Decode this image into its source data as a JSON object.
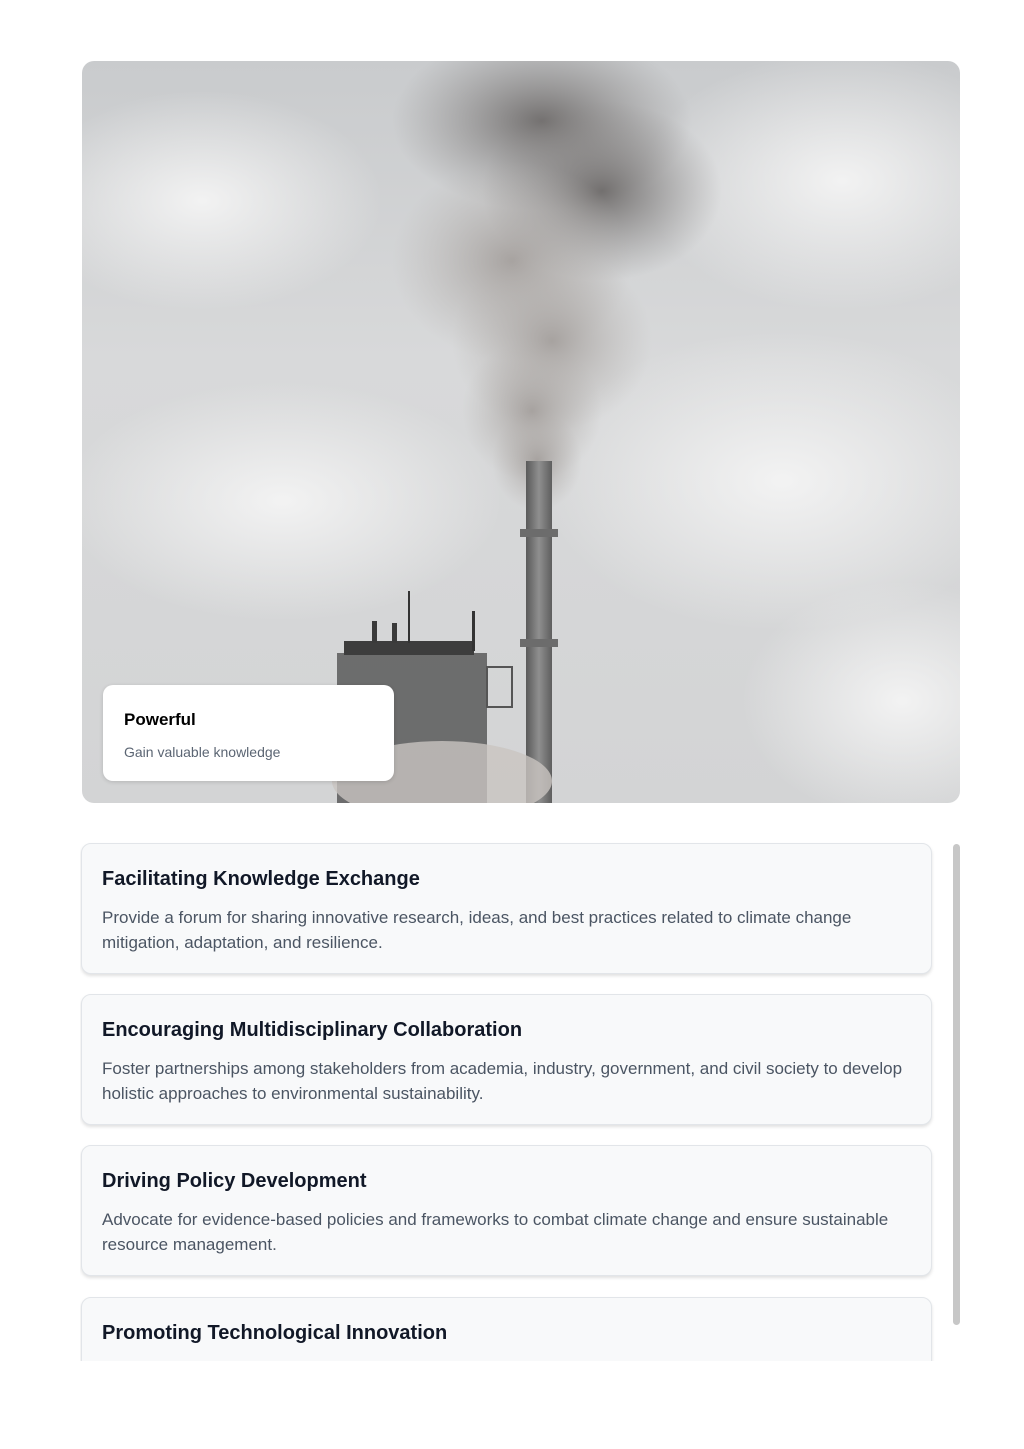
{
  "hero": {
    "image_description_icon": "smokestack-photo",
    "card": {
      "title": "Powerful",
      "subtitle": "Gain valuable knowledge"
    }
  },
  "objectives": [
    {
      "title": "Facilitating Knowledge Exchange",
      "description": "Provide a forum for sharing innovative research, ideas, and best practices related to climate change mitigation, adaptation, and resilience."
    },
    {
      "title": "Encouraging Multidisciplinary Collaboration",
      "description": "Foster partnerships among stakeholders from academia, industry, government, and civil society to develop holistic approaches to environmental sustainability."
    },
    {
      "title": "Driving Policy Development",
      "description": "Advocate for evidence-based policies and frameworks to combat climate change and ensure sustainable resource management."
    },
    {
      "title": "Promoting Technological Innovation",
      "description": ""
    }
  ],
  "colors": {
    "card_bg": "#f8f9fa",
    "title_text": "#111827",
    "body_text": "#4b5563",
    "scrollbar": "#c7c7c7"
  }
}
